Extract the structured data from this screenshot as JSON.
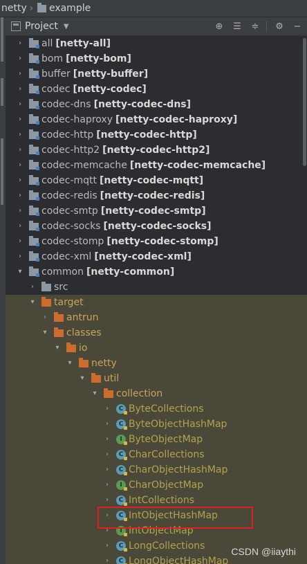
{
  "breadcrumb": {
    "items": [
      "netty",
      "example"
    ]
  },
  "header": {
    "title": "Project"
  },
  "tree": [
    {
      "depth": 0,
      "arrow": "right",
      "icon": "mfold",
      "name": "all",
      "artifact": "[netty-all]",
      "color": "w",
      "tint": false
    },
    {
      "depth": 0,
      "arrow": "right",
      "icon": "mfold",
      "name": "bom",
      "artifact": "[netty-bom]",
      "color": "w",
      "tint": false
    },
    {
      "depth": 0,
      "arrow": "right",
      "icon": "mfold",
      "name": "buffer",
      "artifact": "[netty-buffer]",
      "color": "w",
      "tint": false
    },
    {
      "depth": 0,
      "arrow": "right",
      "icon": "mfold",
      "name": "codec",
      "artifact": "[netty-codec]",
      "color": "w",
      "tint": false
    },
    {
      "depth": 0,
      "arrow": "right",
      "icon": "mfold",
      "name": "codec-dns",
      "artifact": "[netty-codec-dns]",
      "color": "w",
      "tint": false
    },
    {
      "depth": 0,
      "arrow": "right",
      "icon": "mfold",
      "name": "codec-haproxy",
      "artifact": "[netty-codec-haproxy]",
      "color": "w",
      "tint": false
    },
    {
      "depth": 0,
      "arrow": "right",
      "icon": "mfold",
      "name": "codec-http",
      "artifact": "[netty-codec-http]",
      "color": "w",
      "tint": false
    },
    {
      "depth": 0,
      "arrow": "right",
      "icon": "mfold",
      "name": "codec-http2",
      "artifact": "[netty-codec-http2]",
      "color": "w",
      "tint": false
    },
    {
      "depth": 0,
      "arrow": "right",
      "icon": "mfold",
      "name": "codec-memcache",
      "artifact": "[netty-codec-memcache]",
      "color": "w",
      "tint": false
    },
    {
      "depth": 0,
      "arrow": "right",
      "icon": "mfold",
      "name": "codec-mqtt",
      "artifact": "[netty-codec-mqtt]",
      "color": "w",
      "tint": false
    },
    {
      "depth": 0,
      "arrow": "right",
      "icon": "mfold",
      "name": "codec-redis",
      "artifact": "[netty-codec-redis]",
      "color": "w",
      "tint": false
    },
    {
      "depth": 0,
      "arrow": "right",
      "icon": "mfold",
      "name": "codec-smtp",
      "artifact": "[netty-codec-smtp]",
      "color": "w",
      "tint": false
    },
    {
      "depth": 0,
      "arrow": "right",
      "icon": "mfold",
      "name": "codec-socks",
      "artifact": "[netty-codec-socks]",
      "color": "w",
      "tint": false
    },
    {
      "depth": 0,
      "arrow": "right",
      "icon": "mfold",
      "name": "codec-stomp",
      "artifact": "[netty-codec-stomp]",
      "color": "w",
      "tint": false
    },
    {
      "depth": 0,
      "arrow": "right",
      "icon": "mfold",
      "name": "codec-xml",
      "artifact": "[netty-codec-xml]",
      "color": "w",
      "tint": false
    },
    {
      "depth": 0,
      "arrow": "down",
      "icon": "mfold",
      "name": "common",
      "artifact": "[netty-common]",
      "color": "w",
      "tint": false
    },
    {
      "depth": 1,
      "arrow": "right",
      "icon": "gfold",
      "name": "src",
      "artifact": "",
      "color": "w",
      "tint": false
    },
    {
      "depth": 1,
      "arrow": "down",
      "icon": "ofold",
      "name": "target",
      "artifact": "",
      "color": "o",
      "tint": true
    },
    {
      "depth": 2,
      "arrow": "right",
      "icon": "ofold",
      "name": "antrun",
      "artifact": "",
      "color": "o",
      "tint": true
    },
    {
      "depth": 2,
      "arrow": "down",
      "icon": "ofold",
      "name": "classes",
      "artifact": "",
      "color": "o",
      "tint": true
    },
    {
      "depth": 3,
      "arrow": "down",
      "icon": "ofold",
      "name": "io",
      "artifact": "",
      "color": "o",
      "tint": true
    },
    {
      "depth": 4,
      "arrow": "down",
      "icon": "ofold",
      "name": "netty",
      "artifact": "",
      "color": "o",
      "tint": true
    },
    {
      "depth": 5,
      "arrow": "down",
      "icon": "ofold",
      "name": "util",
      "artifact": "",
      "color": "o",
      "tint": true
    },
    {
      "depth": 6,
      "arrow": "down",
      "icon": "ofold",
      "name": "collection",
      "artifact": "",
      "color": "o",
      "tint": true
    },
    {
      "depth": 7,
      "arrow": "right",
      "icon": "cls",
      "name": "ByteCollections",
      "artifact": "",
      "color": "y",
      "tint": true
    },
    {
      "depth": 7,
      "arrow": "right",
      "icon": "cls",
      "name": "ByteObjectHashMap",
      "artifact": "",
      "color": "y",
      "tint": true
    },
    {
      "depth": 7,
      "arrow": "right",
      "icon": "iface",
      "name": "ByteObjectMap",
      "artifact": "",
      "color": "y",
      "tint": true
    },
    {
      "depth": 7,
      "arrow": "right",
      "icon": "cls",
      "name": "CharCollections",
      "artifact": "",
      "color": "y",
      "tint": true
    },
    {
      "depth": 7,
      "arrow": "right",
      "icon": "cls",
      "name": "CharObjectHashMap",
      "artifact": "",
      "color": "y",
      "tint": true
    },
    {
      "depth": 7,
      "arrow": "right",
      "icon": "iface",
      "name": "CharObjectMap",
      "artifact": "",
      "color": "y",
      "tint": true
    },
    {
      "depth": 7,
      "arrow": "right",
      "icon": "cls",
      "name": "IntCollections",
      "artifact": "",
      "color": "y",
      "tint": true
    },
    {
      "depth": 7,
      "arrow": "right",
      "icon": "cls",
      "name": "IntObjectHashMap",
      "artifact": "",
      "color": "y",
      "tint": true
    },
    {
      "depth": 7,
      "arrow": "right",
      "icon": "iface",
      "name": "IntObjectMap",
      "artifact": "",
      "color": "y",
      "tint": true
    },
    {
      "depth": 7,
      "arrow": "right",
      "icon": "cls",
      "name": "LongCollections",
      "artifact": "",
      "color": "y",
      "tint": true
    },
    {
      "depth": 7,
      "arrow": "right",
      "icon": "cls",
      "name": "LongObjectHashMap",
      "artifact": "",
      "color": "y",
      "tint": true
    }
  ],
  "watermark": "CSDN @iiaythi"
}
